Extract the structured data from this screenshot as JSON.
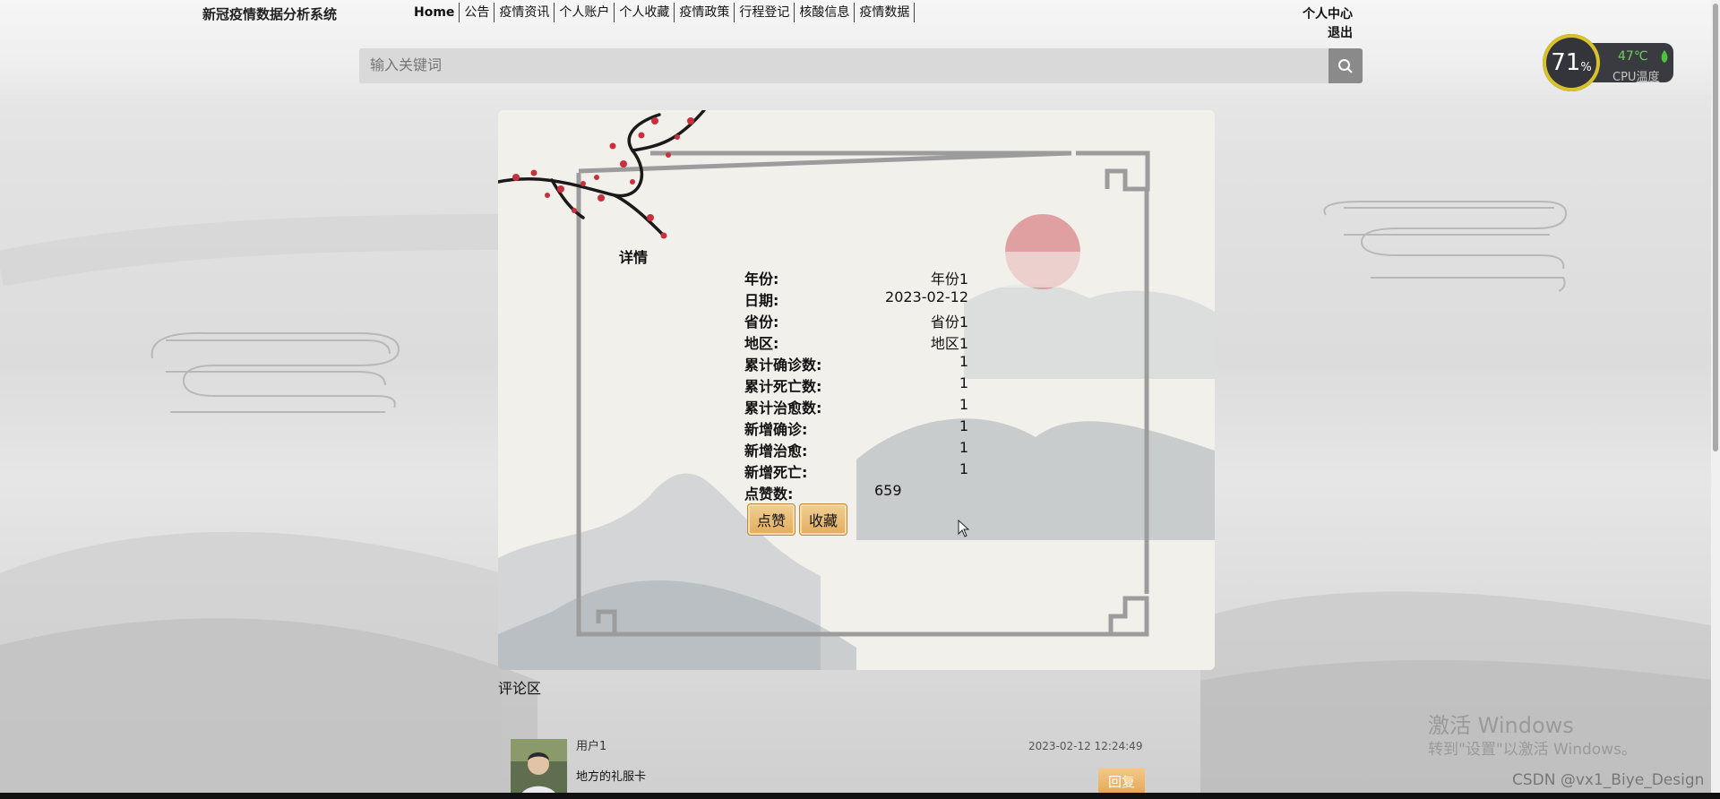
{
  "header": {
    "site_title": "新冠疫情数据分析系统",
    "nav": [
      "Home",
      "公告",
      "疫情资讯",
      "个人账户",
      "个人收藏",
      "疫情政策",
      "行程登记",
      "核酸信息",
      "疫情数据"
    ],
    "user_center": "个人中心",
    "logout": "退出",
    "search_placeholder": "输入关键词"
  },
  "cpu_widget": {
    "percent": "71",
    "percent_unit": "%",
    "temperature": "47℃",
    "label_cpu": "CPU",
    "label_temp": "温度"
  },
  "details": {
    "title": "详情",
    "rows": [
      {
        "label": "年份:",
        "value": "年份1"
      },
      {
        "label": "日期:",
        "value": "2023-02-12"
      },
      {
        "label": "省份:",
        "value": "省份1"
      },
      {
        "label": "地区:",
        "value": "地区1"
      },
      {
        "label": "累计确诊数:",
        "value": "1"
      },
      {
        "label": "累计死亡数:",
        "value": "1"
      },
      {
        "label": "累计治愈数:",
        "value": "1"
      },
      {
        "label": "新增确诊:",
        "value": "1"
      },
      {
        "label": "新增治愈:",
        "value": "1"
      },
      {
        "label": "新增死亡:",
        "value": "1"
      }
    ],
    "likes_label": "点赞数:",
    "likes_value": "659",
    "like_button": "点赞",
    "favorite_button": "收藏"
  },
  "comments": {
    "title": "评论区",
    "items": [
      {
        "user": "用户1",
        "text": "地方的礼服卡",
        "time": "2023-02-12 12:24:49",
        "reply": "回复"
      }
    ]
  },
  "watermark": {
    "line1": "激活 Windows",
    "line2": "转到\"设置\"以激活 Windows。",
    "csdn": "CSDN @vx1_Biye_Design"
  }
}
